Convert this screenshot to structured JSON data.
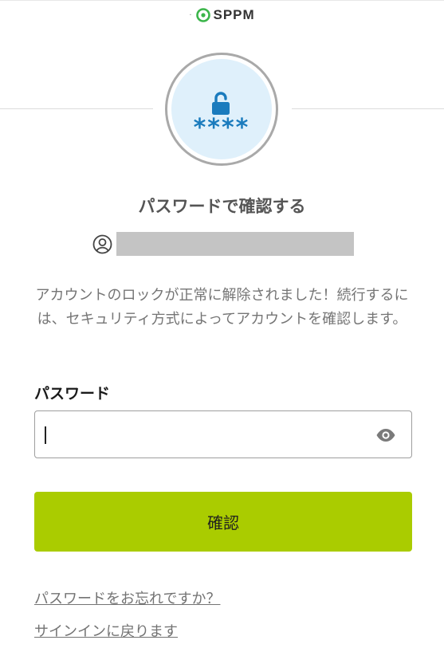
{
  "brand": {
    "name": "SPPM",
    "dots": "·",
    "mark_color": "#3bb54a"
  },
  "badge": {
    "lock_icon": "unlocked-padlock-icon",
    "stars": "****",
    "accent_color": "#1a7bbd",
    "background_color": "#dff0fb"
  },
  "page": {
    "title": "パスワードで確認する",
    "user_icon": "user-circle-icon",
    "message": "アカウントのロックが正常に解除されました！続行するには、セキュリティ方式によってアカウントを確認します。"
  },
  "form": {
    "password_label": "パスワード",
    "password_value": "",
    "password_placeholder": "",
    "show_password_icon": "eye-icon",
    "submit_label": "確認",
    "submit_color": "#aacc00"
  },
  "links": {
    "forgot_password": "パスワードをお忘れですか？",
    "back_to_signin": "サインインに戻ります"
  }
}
